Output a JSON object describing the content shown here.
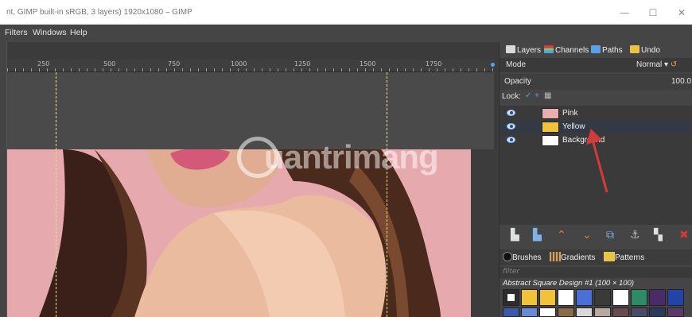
{
  "window": {
    "title": "nt, GIMP built-in sRGB, 3 layers) 1920x1080 – GIMP",
    "minimize_glyph": "—",
    "maximize_glyph": "☐",
    "close_glyph": "✕"
  },
  "menu": [
    "Filters",
    "Windows",
    "Help"
  ],
  "ruler": {
    "labels": [
      "250",
      "500",
      "750",
      "1000",
      "1250",
      "1500",
      "1750"
    ]
  },
  "watermark": {
    "text": "uantrimang"
  },
  "dock": {
    "tabs": [
      {
        "label": "Layers",
        "icon": "layers-icon",
        "color": "#d9d9d9"
      },
      {
        "label": "Channels",
        "icon": "channels-icon",
        "color": "#7cc36b"
      },
      {
        "label": "Paths",
        "icon": "paths-icon",
        "color": "#5aa0e6"
      },
      {
        "label": "Undo",
        "icon": "undo-icon",
        "color": "#e9c343"
      }
    ],
    "mode_label": "Mode",
    "mode_value": "Normal",
    "opacity_label": "Opacity",
    "opacity_value": "100.0",
    "lock_label": "Lock:",
    "layers": [
      {
        "name": "Pink",
        "thumb_color": "#e8aeb2",
        "selected": false
      },
      {
        "name": "Yellow",
        "thumb_color": "#f2c23a",
        "selected": true
      },
      {
        "name": "Background",
        "thumb_color": "#ffffff",
        "selected": false
      }
    ],
    "resource_tabs": [
      {
        "label": "Brushes",
        "icon": "brushes-icon"
      },
      {
        "label": "Gradients",
        "icon": "gradients-icon"
      },
      {
        "label": "Patterns",
        "icon": "patterns-icon"
      }
    ],
    "filter_placeholder": "filter",
    "brush_name": "Abstract Square Design #1 (100 × 100)",
    "brush_colors": [
      "#ffffff",
      "#f2c23a",
      "#f2c23a",
      "#ffffff",
      "#4a6fd8",
      "#3a3a3a",
      "#ffffff",
      "#2f8a6a",
      "#4a2a6a",
      "#2244aa"
    ]
  },
  "colors": {
    "accent_red": "#d43a3a",
    "guide": "#e4e07a"
  }
}
